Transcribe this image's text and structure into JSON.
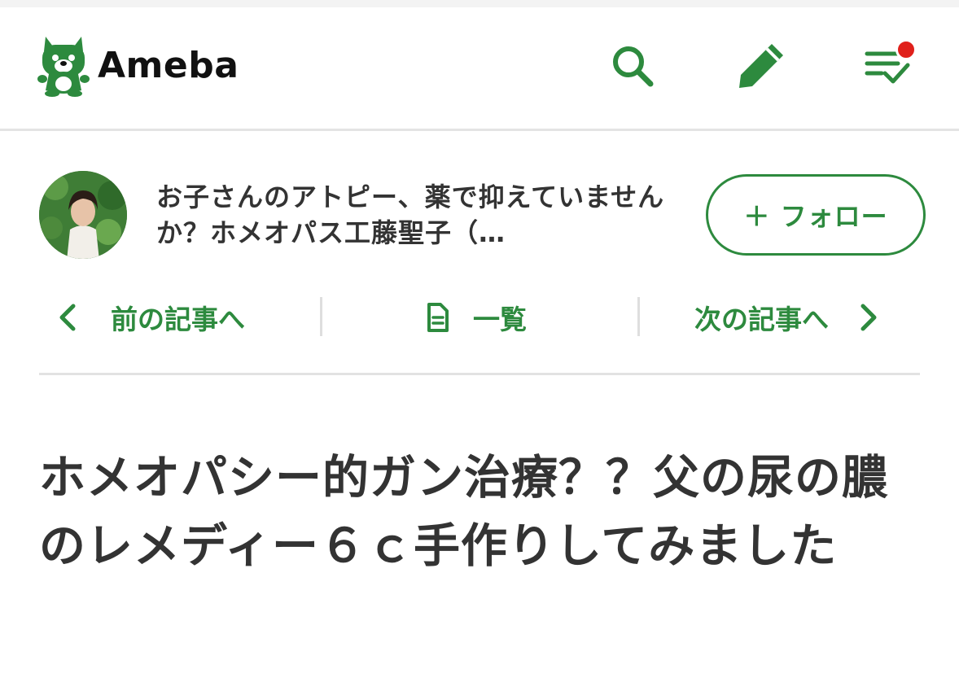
{
  "app": {
    "logo_text": "Ameba",
    "brand_color": "#2d8a3e",
    "notification_color": "#e0201b"
  },
  "header": {
    "icons": [
      "search-icon",
      "pencil-icon",
      "reader-list-icon"
    ]
  },
  "blog": {
    "title": "お子さんのアトピー、薬で抑えていませんか？ホメオパス工藤聖子（…",
    "follow_label": "＋ フォロー"
  },
  "nav": {
    "prev_label": "前の記事へ",
    "list_label": "一覧",
    "next_label": "次の記事へ"
  },
  "article": {
    "title": "ホメオパシー的ガン治療？？父の尿の膿のレメディー６ｃ手作りしてみました"
  }
}
